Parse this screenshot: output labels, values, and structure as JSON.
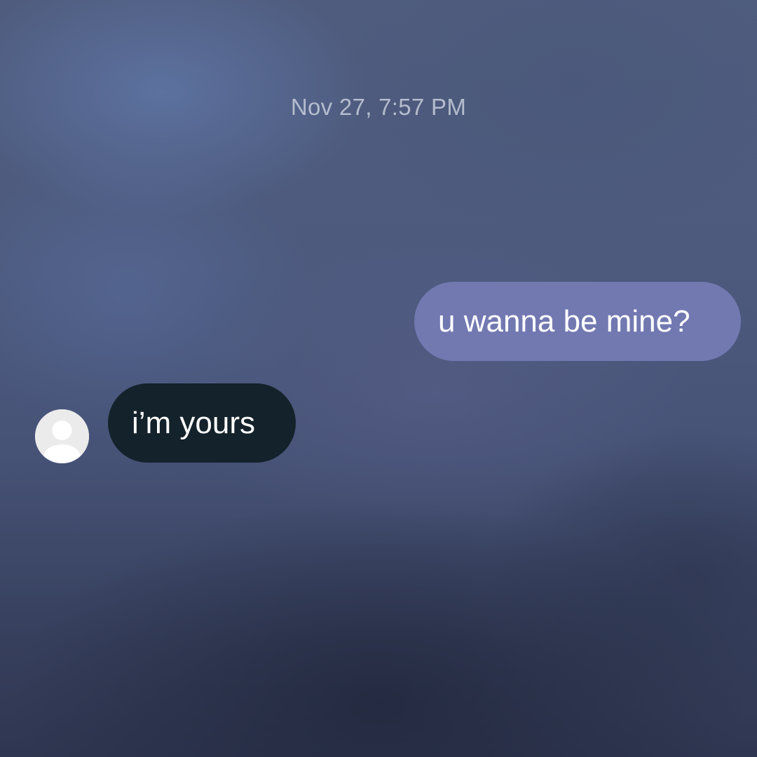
{
  "conversation": {
    "timestamp": "Nov 27, 7:57 PM",
    "messages": [
      {
        "direction": "sent",
        "text": "u wanna be mine?"
      },
      {
        "direction": "received",
        "text": "i’m yours"
      }
    ]
  },
  "icons": {
    "avatar": "default-person-avatar-icon"
  },
  "colors": {
    "sent_bubble": "#7279b1",
    "received_bubble": "#14222b",
    "timestamp_text": "#b4bccd",
    "avatar_bg": "#ebebeb"
  }
}
